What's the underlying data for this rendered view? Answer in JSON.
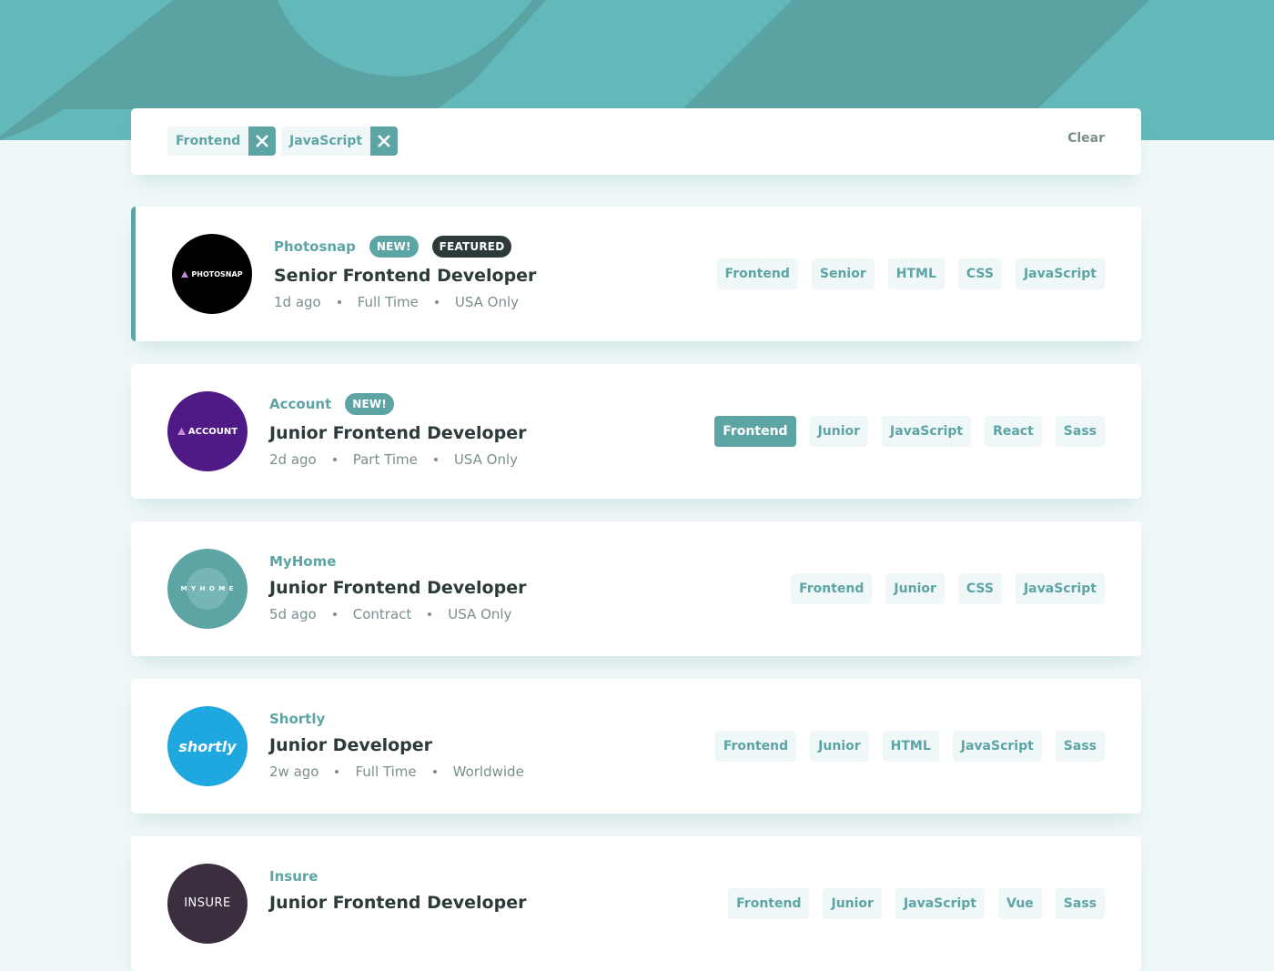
{
  "colors": {
    "primary": "#5da4a4",
    "header_bg": "#63b9ba",
    "page_bg": "#eff7f8",
    "dark": "#2c3a3a",
    "muted": "#7b8e8e"
  },
  "filters": {
    "chips": [
      "Frontend",
      "JavaScript"
    ],
    "remove_icon": "close-icon",
    "clear_label": "Clear"
  },
  "jobs": [
    {
      "company": "Photosnap",
      "new_label": "NEW!",
      "featured_label": "FEATURED",
      "position": "Senior Frontend Developer",
      "posted": "1d ago",
      "contract": "Full Time",
      "location": "USA Only",
      "logo_text": "PHOTOSNAP",
      "logo_bg": "#000000",
      "tags": [
        "Frontend",
        "Senior",
        "HTML",
        "CSS",
        "JavaScript"
      ]
    },
    {
      "company": "Account",
      "new_label": "NEW!",
      "position": "Junior Frontend Developer",
      "posted": "2d ago",
      "contract": "Part Time",
      "location": "USA Only",
      "logo_text": "ACCOUNT",
      "logo_bg": "#4f1a86",
      "tags": [
        "Frontend",
        "Junior",
        "JavaScript",
        "React",
        "Sass"
      ],
      "active_tag": "Frontend"
    },
    {
      "company": "MyHome",
      "position": "Junior Frontend Developer",
      "posted": "5d ago",
      "contract": "Contract",
      "location": "USA Only",
      "logo_text": "M Y H O M E",
      "logo_bg": "#5da4a4",
      "tags": [
        "Frontend",
        "Junior",
        "CSS",
        "JavaScript"
      ]
    },
    {
      "company": "Shortly",
      "position": "Junior Developer",
      "posted": "2w ago",
      "contract": "Full Time",
      "location": "Worldwide",
      "logo_text": "shortly",
      "logo_bg": "#1ea8df",
      "tags": [
        "Frontend",
        "Junior",
        "HTML",
        "JavaScript",
        "Sass"
      ]
    },
    {
      "company": "Insure",
      "position": "Junior Frontend Developer",
      "logo_text": "INSURE",
      "logo_bg": "#3b2e3f",
      "tags": [
        "Frontend",
        "Junior",
        "JavaScript",
        "Vue",
        "Sass"
      ]
    }
  ]
}
